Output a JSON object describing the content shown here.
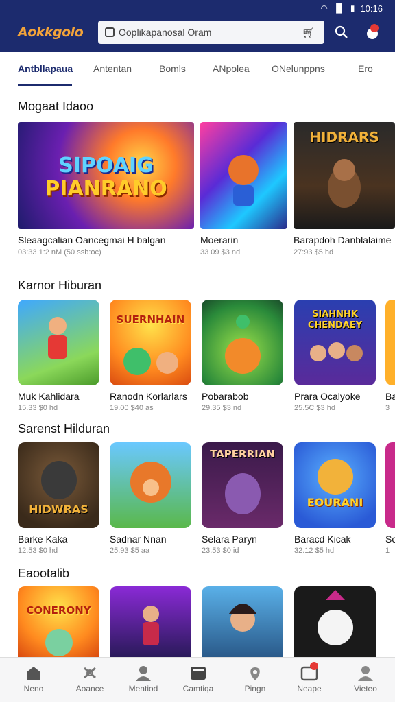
{
  "status": {
    "time": "10:16"
  },
  "app": {
    "logo": "Aokkgolo"
  },
  "search": {
    "value": "Ooplikapanosal Oram"
  },
  "tabs": [
    {
      "label": "Antbllapaua",
      "active": true
    },
    {
      "label": "Antentan"
    },
    {
      "label": "Bomls"
    },
    {
      "label": "ANpolea"
    },
    {
      "label": "ONelunppns"
    },
    {
      "label": "Ero"
    }
  ],
  "sections": [
    {
      "title": "Mogaat Idaoo",
      "items": [
        {
          "title": "Sleaagcalian Oancegmai H balgan",
          "meta": "03:33 1:2 nM (50 ssb:oc)",
          "art": "SIPOAIG PIANRANO"
        },
        {
          "title": "Moerarin",
          "meta": "33 09  $3 nd",
          "art": ""
        },
        {
          "title": "Barapdoh Danblalaime",
          "meta": "27:93  $5 hd",
          "art": "HIDRARS"
        }
      ]
    },
    {
      "title": "Karnor Hiburan",
      "items": [
        {
          "title": "Muk Kahlidara",
          "meta": "15.33  $0 hd",
          "art": ""
        },
        {
          "title": "Ranodn Korlarlars",
          "meta": "19.00  $40 as",
          "art": "SUERNHAIN"
        },
        {
          "title": "Pobarabob",
          "meta": "29.35  $3 nd",
          "art": ""
        },
        {
          "title": "Prara Ocalyoke",
          "meta": "25.5C  $3 hd",
          "art": "SIAHNHK CHENDAEY"
        },
        {
          "title": "Ba",
          "meta": "3",
          "art": ""
        }
      ]
    },
    {
      "title": "Sarenst Hilduran",
      "items": [
        {
          "title": "Barke Kaka",
          "meta": "12.53  $0 hd",
          "art": "HIDWRAS"
        },
        {
          "title": "Sadnar Nnan",
          "meta": "25.93  $5 aa",
          "art": ""
        },
        {
          "title": "Selara Paryn",
          "meta": "23.53  $0 id",
          "art": "TAPERRIAN"
        },
        {
          "title": "Baracd Kicak",
          "meta": "32.12  $5 hd",
          "art": "EOURANI"
        },
        {
          "title": "So",
          "meta": "1",
          "art": ""
        }
      ]
    },
    {
      "title": "Eaootalib",
      "items": [
        {
          "title": "",
          "meta": "",
          "art": "CONERONY"
        },
        {
          "title": "",
          "meta": "",
          "art": ""
        },
        {
          "title": "",
          "meta": "",
          "art": ""
        },
        {
          "title": "",
          "meta": "",
          "art": ""
        }
      ]
    }
  ],
  "bottom_nav": [
    {
      "label": "Neno",
      "icon": "home-icon"
    },
    {
      "label": "Aoance",
      "icon": "gamepad-icon",
      "active": true
    },
    {
      "label": "Mentiod",
      "icon": "person-icon"
    },
    {
      "label": "Camtiqa",
      "icon": "folder-icon",
      "dark": true
    },
    {
      "label": "Pingn",
      "icon": "location-icon"
    },
    {
      "label": "Neape",
      "icon": "inbox-icon",
      "dark": true
    },
    {
      "label": "Vieteo",
      "icon": "account-icon"
    }
  ],
  "colors": {
    "header": "#1c2b6e",
    "accent": "#e8732b",
    "badge": "#e53935"
  }
}
